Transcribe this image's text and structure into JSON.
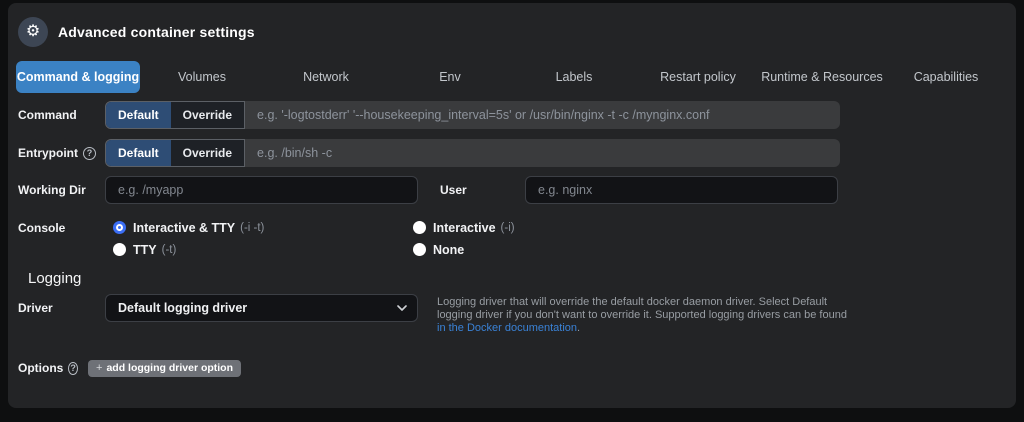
{
  "header": {
    "title": "Advanced container settings"
  },
  "icons": {
    "gear": "⚙",
    "help": "?"
  },
  "tabs": [
    {
      "label": "Command & logging",
      "active": true
    },
    {
      "label": "Volumes",
      "active": false
    },
    {
      "label": "Network",
      "active": false
    },
    {
      "label": "Env",
      "active": false
    },
    {
      "label": "Labels",
      "active": false
    },
    {
      "label": "Restart policy",
      "active": false
    },
    {
      "label": "Runtime & Resources",
      "active": false
    },
    {
      "label": "Capabilities",
      "active": false
    }
  ],
  "form": {
    "command": {
      "label": "Command",
      "toggle": [
        "Default",
        "Override"
      ],
      "active_toggle": "Default",
      "placeholder": "e.g. '-logtostderr' '--housekeeping_interval=5s' or /usr/bin/nginx -t -c /mynginx.conf",
      "value": ""
    },
    "entrypoint": {
      "label": "Entrypoint",
      "toggle": [
        "Default",
        "Override"
      ],
      "active_toggle": "Default",
      "placeholder": "e.g. /bin/sh -c",
      "value": ""
    },
    "working_dir": {
      "label": "Working Dir",
      "placeholder": "e.g. /myapp",
      "value": ""
    },
    "user": {
      "label": "User",
      "placeholder": "e.g. nginx",
      "value": ""
    },
    "console": {
      "label": "Console",
      "options": [
        {
          "label": "Interactive & TTY",
          "flag": "(-i -t)",
          "selected": true
        },
        {
          "label": "Interactive",
          "flag": "(-i)",
          "selected": false
        },
        {
          "label": "TTY",
          "flag": "(-t)",
          "selected": false
        },
        {
          "label": "None",
          "flag": "",
          "selected": false
        }
      ]
    }
  },
  "logging": {
    "section_title": "Logging",
    "driver": {
      "label": "Driver",
      "selected_option": "Default logging driver",
      "description_before": "Logging driver that will override the default docker daemon driver. Select Default logging driver if you don't want to override it. Supported logging drivers can be found ",
      "link_text": "in the Docker documentation",
      "description_after": "."
    },
    "options": {
      "label": "Options",
      "button_prefix": "+",
      "button_label": "add logging driver option"
    }
  },
  "colors": {
    "page_bg": "#0e0f10",
    "panel_bg": "#232426",
    "tab_active_bg": "#3b82c4",
    "toggle_active_bg": "#2e4d75",
    "radio_selected": "#3b6ef5",
    "link": "#3a82d6",
    "options_button_bg": "#6e7177"
  }
}
